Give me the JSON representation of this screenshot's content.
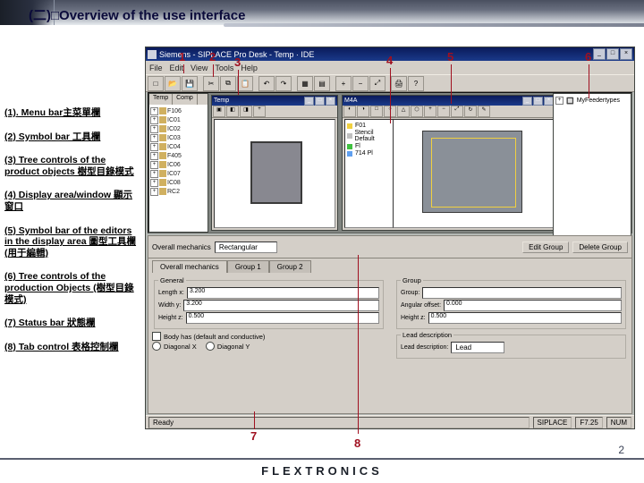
{
  "slide": {
    "title": "(二)□Overview of the use interface",
    "footer_brand": "FLEXTRONICS",
    "page_number": "2"
  },
  "markers": {
    "m1": "1",
    "m2": "2",
    "m3": "3",
    "m4": "4",
    "m5": "5",
    "m6": "6",
    "m7": "7",
    "m8": "8"
  },
  "callouts": {
    "c1": "(1). Menu bar主菜單欄",
    "c2": "(2) Symbol bar 工具欄",
    "c3": "(3) Tree controls of the product objects 樹型目錄模式",
    "c4": "(4) Display area/window 顯示窗口",
    "c5": "(5) Symbol bar of the editors in the display area 圖型工具欄(用于編輯)",
    "c6": "(6) Tree controls of the production Objects (樹型目錄模式)",
    "c7": "(7) Status bar 狀態欄",
    "c8": "(8) Tab control 表格控制欄"
  },
  "app": {
    "window_title": "Siemens - SIPLACE Pro Desk - Temp · IDE",
    "menubar": [
      "File",
      "Edit",
      "View",
      "Tools",
      "Help"
    ],
    "statusbar": {
      "left": "Ready",
      "right1": "SIPLACE",
      "right2": "F7.25",
      "right3": "NUM"
    }
  },
  "left_tree": {
    "tabs": [
      "Temp",
      "Comp"
    ],
    "items": [
      "F106",
      "IC01",
      "IC02",
      "IC03",
      "IC04",
      "F405",
      "IC06",
      "IC07",
      "IC08",
      "RC2"
    ]
  },
  "right_tree": {
    "header": "MyFeedertypes"
  },
  "editor1": {
    "title": "Temp"
  },
  "editor2": {
    "title": "M4A",
    "legend_items": [
      "F01",
      "Stencil Default",
      "Fl",
      "714 Pl"
    ]
  },
  "props": {
    "label": "Overall mechanics",
    "dropdown_value": "Rectangular",
    "btn_edit": "Edit Group",
    "btn_del": "Delete Group",
    "tabs": [
      "Overall mechanics",
      "Group 1",
      "Group 2"
    ],
    "fs1": {
      "legend": "General",
      "length": "Length x:",
      "length_v": "3.200",
      "width": "Width y:",
      "width_v": "3.200",
      "height": "Height z:",
      "height_v": "0.500"
    },
    "fs2": {
      "legend": "Group",
      "group": "Group:",
      "angle": "Angular offset:",
      "angle_v": "0.000",
      "height": "Height z:",
      "height_v": "0.500"
    },
    "fs3": {
      "legend": "Lead description",
      "ld": "Lead description:",
      "ld_v": "Lead"
    },
    "body_ch": "Body has (default and conductive)",
    "r1": "Diagonal X",
    "r2": "Diagonal Y"
  }
}
